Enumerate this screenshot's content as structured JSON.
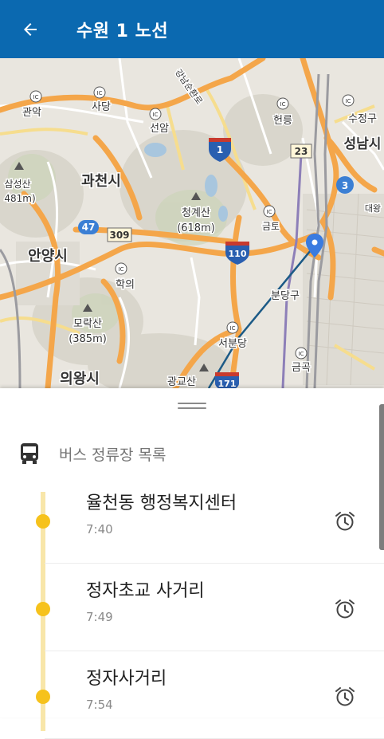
{
  "app_bar": {
    "title": "수원 1 노선",
    "back_icon": "arrow-left-icon"
  },
  "map": {
    "labels": {
      "gwanak": "관악",
      "sadang": "사당",
      "seonbawi": "선암",
      "gwacheon": "과천시",
      "samseongsan": "삼성산",
      "samseongsan_h": "481m)",
      "cheonggyesan": "청계산",
      "cheonggyesan_h": "(618m)",
      "anyang": "안양시",
      "hagui": "학의",
      "moraksan": "모락산",
      "moraksan_h": "(385m)",
      "uiwang": "의왕시",
      "gwanggyosan": "광교산",
      "seongnam": "성남시",
      "sujeong": "수정구",
      "daewang": "대왕",
      "bundang": "분당구",
      "hyeonreung": "헌릉",
      "geumto": "금토",
      "seobundang": "서분당",
      "geumgok": "금곡",
      "expressway": "강남순환로"
    },
    "shields": {
      "r1": "1",
      "r47": "47",
      "r309": "309",
      "r23": "23",
      "r3": "3",
      "r110": "110",
      "r171": "171",
      "ic": "IC"
    },
    "route_color": "#1c5a86",
    "marker_color": "#3a7be0"
  },
  "sheet": {
    "section_title": "버스 정류장 목록",
    "section_icon": "bus-icon",
    "stops": [
      {
        "name": "율천동 행정복지센터",
        "time": "7:40"
      },
      {
        "name": "정자초교 사거리",
        "time": "7:49"
      },
      {
        "name": "정자사거리",
        "time": "7:54"
      }
    ],
    "alarm_icon": "alarm-clock-icon",
    "accent_color": "#f6c21c"
  }
}
